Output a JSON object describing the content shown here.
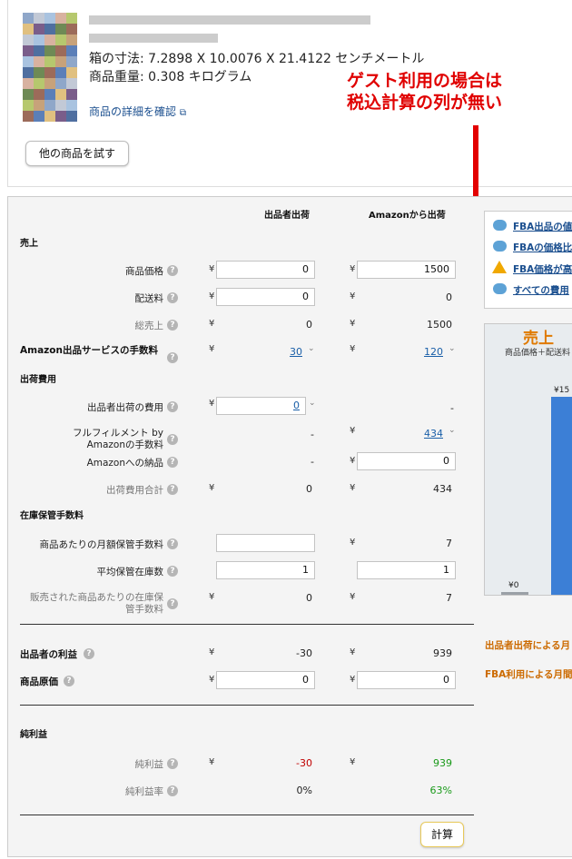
{
  "product": {
    "dimensions": "箱の寸法: 7.2898 X 10.0076 X 21.4122 センチメートル",
    "weight": "商品重量: 0.308 キログラム",
    "details_link": "商品の詳細を確認",
    "try_other_button": "他の商品を試す"
  },
  "annotation": {
    "line1": "ゲスト利用の場合は",
    "line2": "税込計算の列が無い"
  },
  "calculator": {
    "col_seller": "出品者出荷",
    "col_amazon": "Amazonから出荷",
    "currency": "¥",
    "sections": {
      "sales": "売上",
      "fulfillment": "出荷費用",
      "storage": "在庫保管手数料",
      "net_profit": "純利益"
    },
    "rows": {
      "item_price": {
        "label": "商品価格",
        "seller": "0",
        "amazon": "1500"
      },
      "shipping": {
        "label": "配送料",
        "seller": "0",
        "amazon": "0"
      },
      "total_sales": {
        "label": "総売上",
        "seller": "0",
        "amazon": "1500"
      },
      "amazon_fee": {
        "label": "Amazon出品サービスの手数料",
        "seller": "30",
        "amazon": "120"
      },
      "seller_ship_cost": {
        "label": "出品者出荷の費用",
        "seller": "0",
        "amazon": "-"
      },
      "fba_fee": {
        "label_line1": "フルフィルメント by",
        "label_line2": "Amazonの手数料",
        "seller": "-",
        "amazon": "434"
      },
      "inbound": {
        "label": "Amazonへの納品",
        "seller": "-",
        "amazon": "0"
      },
      "ship_total": {
        "label": "出荷費用合計",
        "seller": "0",
        "amazon": "434"
      },
      "monthly_storage": {
        "label": "商品あたりの月額保管手数料",
        "seller": "",
        "amazon": "7"
      },
      "avg_inventory": {
        "label": "平均保管在庫数",
        "seller": "1",
        "amazon": "1"
      },
      "storage_per_sold": {
        "label_line1": "販売された商品あたりの在庫保",
        "label_line2": "管手数料",
        "seller": "0",
        "amazon": "7"
      },
      "seller_profit": {
        "label": "出品者の利益",
        "seller": "-30",
        "amazon": "939"
      },
      "cost": {
        "label": "商品原価",
        "seller": "0",
        "amazon": "0"
      },
      "net_profit": {
        "label": "純利益",
        "seller": "-30",
        "amazon": "939"
      },
      "net_margin": {
        "label": "純利益率",
        "seller": "0%",
        "amazon": "63%"
      }
    },
    "calc_button": "計算"
  },
  "sidebar": {
    "links": [
      {
        "label": "FBA出品の値",
        "icon": "speech-bubble-icon"
      },
      {
        "label": "FBAの価格比",
        "icon": "speech-bubble-icon"
      },
      {
        "label": "FBA価格が高",
        "icon": "warning-icon"
      },
      {
        "label": "すべての費用",
        "icon": "speech-bubble-icon"
      }
    ],
    "chart_title": "売上",
    "chart_subtitle": "商品価格＋配送料",
    "bar_seller_label": "¥0",
    "bar_amazon_label": "¥15",
    "seller_monthly": "出品者出荷による月",
    "fba_monthly": "FBA利用による月間"
  },
  "colors": {
    "annotation_red": "#e00000",
    "chart_blue": "#3c7fd6",
    "accent_orange": "#e07a00"
  }
}
